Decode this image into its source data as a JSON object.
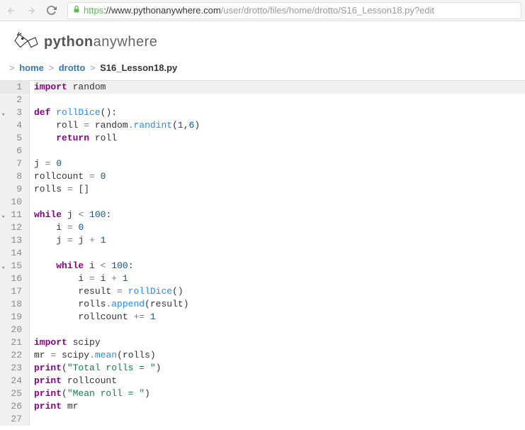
{
  "browser": {
    "url_https": "https",
    "url_domain": "://www.pythonanywhere.com",
    "url_path": "/user/drotto/files/home/drotto/S16_Lesson18.py?edit"
  },
  "logo": {
    "prefix": "python",
    "suffix": "anywhere"
  },
  "breadcrumb": {
    "sep": ">",
    "items": [
      {
        "label": "home",
        "link": true
      },
      {
        "label": "drotto",
        "link": true
      },
      {
        "label": "S16_Lesson18.py",
        "link": false
      }
    ]
  },
  "editor": {
    "active_line": 1,
    "lines": [
      {
        "n": 1,
        "fold": false,
        "tokens": [
          {
            "t": "kw",
            "v": "import"
          },
          {
            "t": "sp",
            "v": " "
          },
          {
            "t": "id",
            "v": "random"
          }
        ]
      },
      {
        "n": 2,
        "fold": false,
        "tokens": []
      },
      {
        "n": 3,
        "fold": true,
        "tokens": [
          {
            "t": "kw",
            "v": "def"
          },
          {
            "t": "sp",
            "v": " "
          },
          {
            "t": "def",
            "v": "rollDice"
          },
          {
            "t": "paren",
            "v": "():"
          }
        ]
      },
      {
        "n": 4,
        "fold": false,
        "tokens": [
          {
            "t": "sp",
            "v": "    "
          },
          {
            "t": "id",
            "v": "roll"
          },
          {
            "t": "sp",
            "v": " "
          },
          {
            "t": "op",
            "v": "="
          },
          {
            "t": "sp",
            "v": " "
          },
          {
            "t": "id",
            "v": "random"
          },
          {
            "t": "op",
            "v": "."
          },
          {
            "t": "call",
            "v": "randint"
          },
          {
            "t": "paren",
            "v": "("
          },
          {
            "t": "num",
            "v": "1"
          },
          {
            "t": "paren",
            "v": ","
          },
          {
            "t": "num",
            "v": "6"
          },
          {
            "t": "paren",
            "v": ")"
          }
        ]
      },
      {
        "n": 5,
        "fold": false,
        "tokens": [
          {
            "t": "sp",
            "v": "    "
          },
          {
            "t": "kw",
            "v": "return"
          },
          {
            "t": "sp",
            "v": " "
          },
          {
            "t": "id",
            "v": "roll"
          }
        ]
      },
      {
        "n": 6,
        "fold": false,
        "tokens": []
      },
      {
        "n": 7,
        "fold": false,
        "tokens": [
          {
            "t": "id",
            "v": "j"
          },
          {
            "t": "sp",
            "v": " "
          },
          {
            "t": "op",
            "v": "="
          },
          {
            "t": "sp",
            "v": " "
          },
          {
            "t": "num",
            "v": "0"
          }
        ]
      },
      {
        "n": 8,
        "fold": false,
        "tokens": [
          {
            "t": "id",
            "v": "rollcount"
          },
          {
            "t": "sp",
            "v": " "
          },
          {
            "t": "op",
            "v": "="
          },
          {
            "t": "sp",
            "v": " "
          },
          {
            "t": "num",
            "v": "0"
          }
        ]
      },
      {
        "n": 9,
        "fold": false,
        "tokens": [
          {
            "t": "id",
            "v": "rolls"
          },
          {
            "t": "sp",
            "v": " "
          },
          {
            "t": "op",
            "v": "="
          },
          {
            "t": "sp",
            "v": " "
          },
          {
            "t": "paren",
            "v": "[]"
          }
        ]
      },
      {
        "n": 10,
        "fold": false,
        "tokens": []
      },
      {
        "n": 11,
        "fold": true,
        "tokens": [
          {
            "t": "kw",
            "v": "while"
          },
          {
            "t": "sp",
            "v": " "
          },
          {
            "t": "id",
            "v": "j"
          },
          {
            "t": "sp",
            "v": " "
          },
          {
            "t": "op",
            "v": "<"
          },
          {
            "t": "sp",
            "v": " "
          },
          {
            "t": "num",
            "v": "100"
          },
          {
            "t": "paren",
            "v": ":"
          }
        ]
      },
      {
        "n": 12,
        "fold": false,
        "tokens": [
          {
            "t": "sp",
            "v": "    "
          },
          {
            "t": "id",
            "v": "i"
          },
          {
            "t": "sp",
            "v": " "
          },
          {
            "t": "op",
            "v": "="
          },
          {
            "t": "sp",
            "v": " "
          },
          {
            "t": "num",
            "v": "0"
          }
        ]
      },
      {
        "n": 13,
        "fold": false,
        "tokens": [
          {
            "t": "sp",
            "v": "    "
          },
          {
            "t": "id",
            "v": "j"
          },
          {
            "t": "sp",
            "v": " "
          },
          {
            "t": "op",
            "v": "="
          },
          {
            "t": "sp",
            "v": " "
          },
          {
            "t": "id",
            "v": "j"
          },
          {
            "t": "sp",
            "v": " "
          },
          {
            "t": "op",
            "v": "+"
          },
          {
            "t": "sp",
            "v": " "
          },
          {
            "t": "num",
            "v": "1"
          }
        ]
      },
      {
        "n": 14,
        "fold": false,
        "tokens": []
      },
      {
        "n": 15,
        "fold": true,
        "tokens": [
          {
            "t": "sp",
            "v": "    "
          },
          {
            "t": "kw",
            "v": "while"
          },
          {
            "t": "sp",
            "v": " "
          },
          {
            "t": "id",
            "v": "i"
          },
          {
            "t": "sp",
            "v": " "
          },
          {
            "t": "op",
            "v": "<"
          },
          {
            "t": "sp",
            "v": " "
          },
          {
            "t": "num",
            "v": "100"
          },
          {
            "t": "paren",
            "v": ":"
          }
        ]
      },
      {
        "n": 16,
        "fold": false,
        "tokens": [
          {
            "t": "sp",
            "v": "        "
          },
          {
            "t": "id",
            "v": "i"
          },
          {
            "t": "sp",
            "v": " "
          },
          {
            "t": "op",
            "v": "="
          },
          {
            "t": "sp",
            "v": " "
          },
          {
            "t": "id",
            "v": "i"
          },
          {
            "t": "sp",
            "v": " "
          },
          {
            "t": "op",
            "v": "+"
          },
          {
            "t": "sp",
            "v": " "
          },
          {
            "t": "num",
            "v": "1"
          }
        ]
      },
      {
        "n": 17,
        "fold": false,
        "tokens": [
          {
            "t": "sp",
            "v": "        "
          },
          {
            "t": "id",
            "v": "result"
          },
          {
            "t": "sp",
            "v": " "
          },
          {
            "t": "op",
            "v": "="
          },
          {
            "t": "sp",
            "v": " "
          },
          {
            "t": "call",
            "v": "rollDice"
          },
          {
            "t": "paren",
            "v": "()"
          }
        ]
      },
      {
        "n": 18,
        "fold": false,
        "tokens": [
          {
            "t": "sp",
            "v": "        "
          },
          {
            "t": "id",
            "v": "rolls"
          },
          {
            "t": "op",
            "v": "."
          },
          {
            "t": "call",
            "v": "append"
          },
          {
            "t": "paren",
            "v": "("
          },
          {
            "t": "id",
            "v": "result"
          },
          {
            "t": "paren",
            "v": ")"
          }
        ]
      },
      {
        "n": 19,
        "fold": false,
        "tokens": [
          {
            "t": "sp",
            "v": "        "
          },
          {
            "t": "id",
            "v": "rollcount"
          },
          {
            "t": "sp",
            "v": " "
          },
          {
            "t": "op",
            "v": "+="
          },
          {
            "t": "sp",
            "v": " "
          },
          {
            "t": "num",
            "v": "1"
          }
        ]
      },
      {
        "n": 20,
        "fold": false,
        "tokens": []
      },
      {
        "n": 21,
        "fold": false,
        "tokens": [
          {
            "t": "kw",
            "v": "import"
          },
          {
            "t": "sp",
            "v": " "
          },
          {
            "t": "id",
            "v": "scipy"
          }
        ]
      },
      {
        "n": 22,
        "fold": false,
        "tokens": [
          {
            "t": "id",
            "v": "mr"
          },
          {
            "t": "sp",
            "v": " "
          },
          {
            "t": "op",
            "v": "="
          },
          {
            "t": "sp",
            "v": " "
          },
          {
            "t": "id",
            "v": "scipy"
          },
          {
            "t": "op",
            "v": "."
          },
          {
            "t": "call",
            "v": "mean"
          },
          {
            "t": "paren",
            "v": "("
          },
          {
            "t": "id",
            "v": "rolls"
          },
          {
            "t": "paren",
            "v": ")"
          }
        ]
      },
      {
        "n": 23,
        "fold": false,
        "tokens": [
          {
            "t": "kw",
            "v": "print"
          },
          {
            "t": "paren",
            "v": "("
          },
          {
            "t": "str",
            "v": "\"Total rolls = \""
          },
          {
            "t": "paren",
            "v": ")"
          }
        ]
      },
      {
        "n": 24,
        "fold": false,
        "tokens": [
          {
            "t": "kw",
            "v": "print"
          },
          {
            "t": "sp",
            "v": " "
          },
          {
            "t": "id",
            "v": "rollcount"
          }
        ]
      },
      {
        "n": 25,
        "fold": false,
        "tokens": [
          {
            "t": "kw",
            "v": "print"
          },
          {
            "t": "paren",
            "v": "("
          },
          {
            "t": "str",
            "v": "\"Mean roll = \""
          },
          {
            "t": "paren",
            "v": ")"
          }
        ]
      },
      {
        "n": 26,
        "fold": false,
        "tokens": [
          {
            "t": "kw",
            "v": "print"
          },
          {
            "t": "sp",
            "v": " "
          },
          {
            "t": "id",
            "v": "mr"
          }
        ]
      },
      {
        "n": 27,
        "fold": false,
        "tokens": []
      }
    ]
  }
}
